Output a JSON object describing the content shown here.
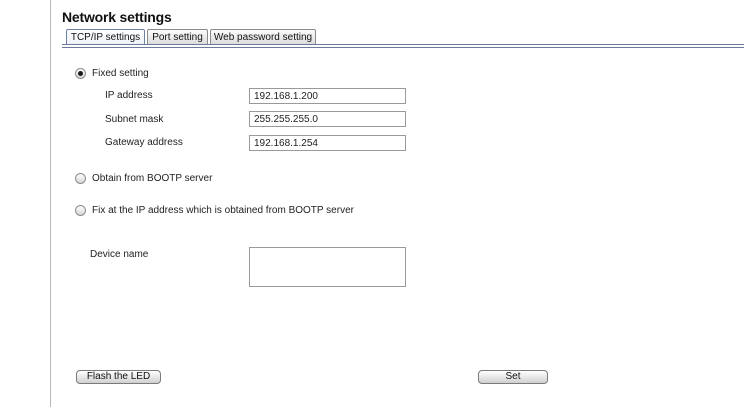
{
  "page": {
    "title": "Network settings"
  },
  "tabs": [
    {
      "label": "TCP/IP settings",
      "active": true
    },
    {
      "label": "Port setting",
      "active": false
    },
    {
      "label": "Web password setting",
      "active": false
    }
  ],
  "ip_mode": {
    "fixed_label": "Fixed setting",
    "bootp_label": "Obtain from BOOTP server",
    "bootp_fix_label": "Fix at the IP address which is obtained from BOOTP server",
    "selected": "fixed"
  },
  "fixed": {
    "ip_label": "IP address",
    "ip_value": "192.168.1.200",
    "subnet_label": "Subnet mask",
    "subnet_value": "255.255.255.0",
    "gateway_label": "Gateway address",
    "gateway_value": "192.168.1.254"
  },
  "device": {
    "name_label": "Device name",
    "name_value": ""
  },
  "buttons": {
    "flash_led": "Flash the LED",
    "set": "Set"
  }
}
